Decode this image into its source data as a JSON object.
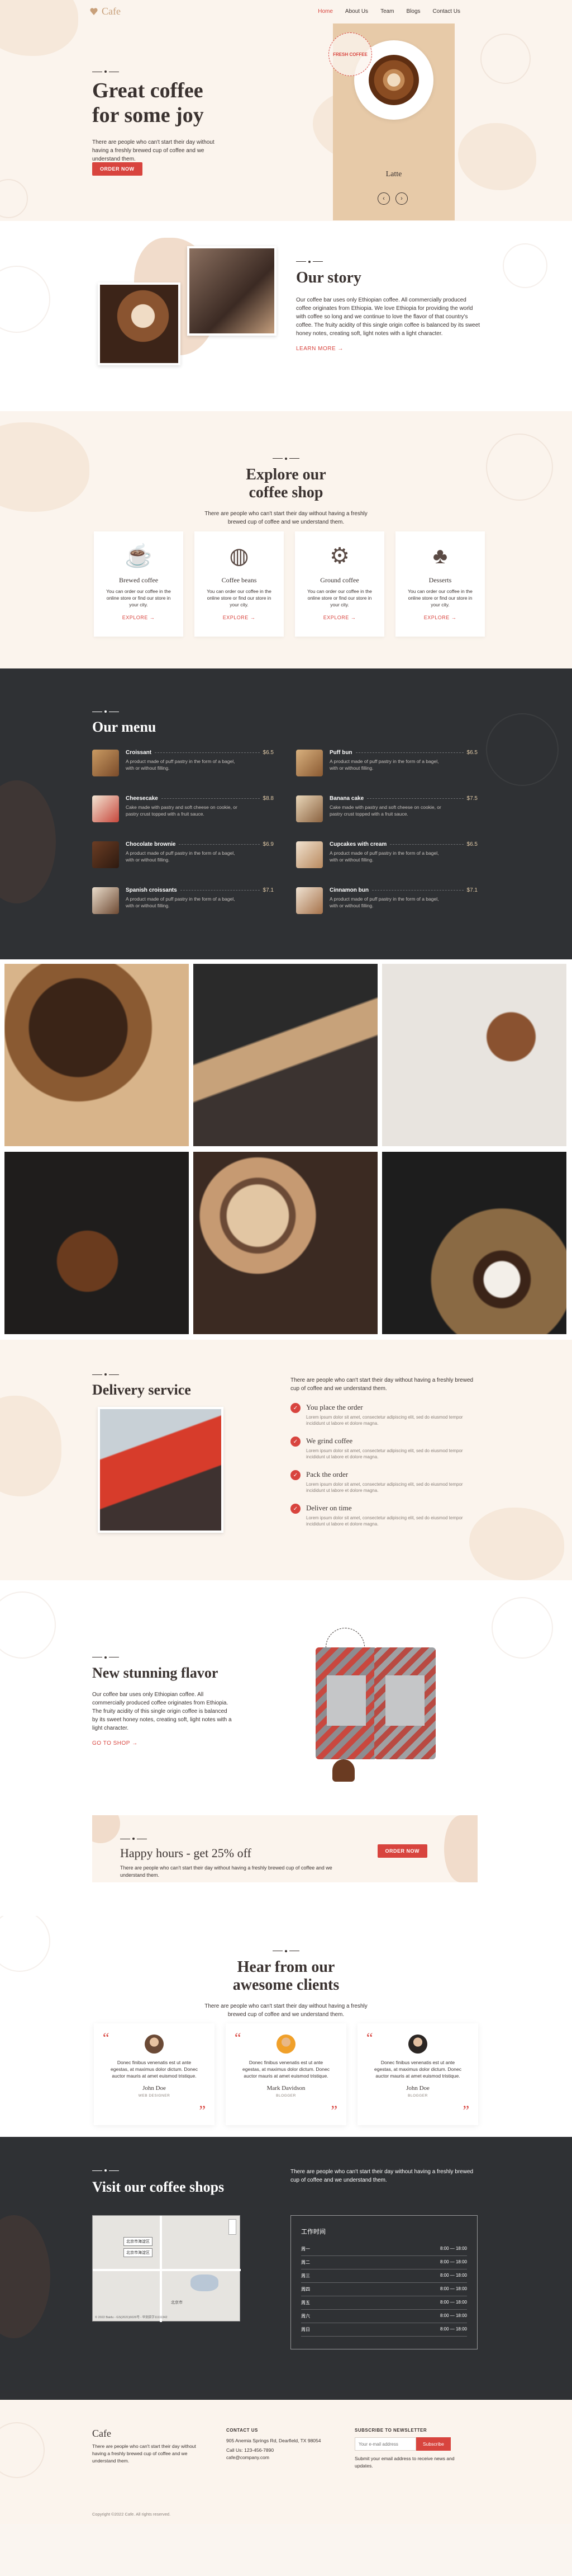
{
  "header": {
    "logo": "Cafe",
    "nav": [
      "Home",
      "About Us",
      "Team",
      "Blogs",
      "Contact Us"
    ]
  },
  "hero": {
    "title_line1": "Great coffee",
    "title_line2": "for some joy",
    "text": "There are people who can't start their day without having a freshly brewed cup of coffee and we understand them.",
    "button": "ORDER NOW",
    "badge": "FRESH COFFEE",
    "cup_label": "Latte",
    "prev": "‹",
    "next": "›"
  },
  "story": {
    "title": "Our story",
    "text": "Our coffee bar uses only Ethiopian coffee. All commercially produced coffee originates from Ethiopia. We love Ethiopia for providing the world with coffee so long and we continue to love the flavor of that country's coffee. The fruity acidity of this single origin coffee is balanced by its sweet honey notes, creating soft, light notes with a light character.",
    "link": "LEARN MORE →"
  },
  "explore": {
    "title_line1": "Explore our",
    "title_line2": "coffee shop",
    "text": "There are people who can't start their day without having a freshly brewed cup of coffee and we understand them.",
    "cards": [
      {
        "title": "Brewed coffee",
        "desc": "You can order our coffee in the online store or find our store in your city.",
        "link": "EXPLORE →",
        "icon": "☕"
      },
      {
        "title": "Coffee beans",
        "desc": "You can order our coffee in the online store or find our store in your city.",
        "link": "EXPLORE →",
        "icon": "◍"
      },
      {
        "title": "Ground coffee",
        "desc": "You can order our coffee in the online store or find our store in your city.",
        "link": "EXPLORE →",
        "icon": "⚙"
      },
      {
        "title": "Desserts",
        "desc": "You can order our coffee in the online store or find our store in your city.",
        "link": "EXPLORE →",
        "icon": "♣"
      }
    ]
  },
  "menu": {
    "title": "Our menu",
    "items": [
      {
        "name": "Croissant",
        "price": "$6.5",
        "desc": "A product made of puff pastry in the form of a bagel, with or without filling."
      },
      {
        "name": "Puff bun",
        "price": "$6.5",
        "desc": "A product made of puff pastry in the form of a bagel, with or without filling."
      },
      {
        "name": "Cheesecake",
        "price": "$8.8",
        "desc": "Cake made with pastry and soft cheese on cookie, or pastry crust topped with a fruit sauce."
      },
      {
        "name": "Banana cake",
        "price": "$7.5",
        "desc": "Cake made with pastry and soft cheese on cookie, or pastry crust topped with a fruit sauce."
      },
      {
        "name": "Chocolate brownie",
        "price": "$6.9",
        "desc": "A product made of puff pastry in the form of a bagel, with or without filling."
      },
      {
        "name": "Cupcakes with cream",
        "price": "$6.5",
        "desc": "A product made of puff pastry in the form of a bagel, with or without filling."
      },
      {
        "name": "Spanish croissants",
        "price": "$7.1",
        "desc": "A product made of puff pastry in the form of a bagel, with or without filling."
      },
      {
        "name": "Cinnamon bun",
        "price": "$7.1",
        "desc": "A product made of puff pastry in the form of a bagel, with or without filling."
      }
    ]
  },
  "delivery": {
    "title": "Delivery service",
    "text": "There are people who can't start their day without having a freshly brewed cup of coffee and we understand them.",
    "steps": [
      {
        "title": "You place the order",
        "desc": "Lorem ipsum dolor sit amet, consectetur adipiscing elit, sed do eiusmod tempor incididunt ut labore et dolore magna."
      },
      {
        "title": "We grind coffee",
        "desc": "Lorem ipsum dolor sit amet, consectetur adipiscing elit, sed do eiusmod tempor incididunt ut labore et dolore magna."
      },
      {
        "title": "Pack the order",
        "desc": "Lorem ipsum dolor sit amet, consectetur adipiscing elit, sed do eiusmod tempor incididunt ut labore et dolore magna."
      },
      {
        "title": "Deliver on time",
        "desc": "Lorem ipsum dolor sit amet, consectetur adipiscing elit, sed do eiusmod tempor incididunt ut labore et dolore magna."
      }
    ]
  },
  "flavor": {
    "title": "New stunning flavor",
    "text": "Our coffee bar uses only Ethiopian coffee. All commercially produced coffee originates from Ethiopia. The fruity acidity of this single origin coffee is balanced by its sweet honey notes, creating soft, light notes with a light character.",
    "link": "GO TO SHOP →"
  },
  "happy": {
    "title": "Happy hours - get 25% off",
    "text": "There are people who can't start their day without having a freshly brewed cup of coffee and we understand them.",
    "button": "ORDER NOW"
  },
  "testimonials": {
    "title_line1": "Hear from our",
    "title_line2": "awesome clients",
    "text": "There are people who can't start their day without having a freshly brewed cup of coffee and we understand them.",
    "items": [
      {
        "text": "Donec finibus venenatis est ut ante egestas, at maximus dolor dictum. Donec auctor mauris at amet euismod tristique.",
        "name": "John Doe",
        "role": "WEB DESIGNER"
      },
      {
        "text": "Donec finibus venenatis est ut ante egestas, at maximus dolor dictum. Donec auctor mauris at amet euismod tristique.",
        "name": "Mark Davidson",
        "role": "BLOGGER"
      },
      {
        "text": "Donec finibus venenatis est ut ante egestas, at maximus dolor dictum. Donec auctor mauris at amet euismod tristique.",
        "name": "John Doe",
        "role": "BLOGGER"
      }
    ]
  },
  "shops": {
    "title": "Visit our coffee shops",
    "text": "There are people who can't start their day without having a freshly brewed cup of coffee and we understand them.",
    "hours_title": "工作时间",
    "hours": [
      {
        "day": "周一",
        "time": "8:00 — 18:00"
      },
      {
        "day": "周二",
        "time": "8:00 — 18:00"
      },
      {
        "day": "周三",
        "time": "8:00 — 18:00"
      },
      {
        "day": "周四",
        "time": "8:00 — 18:00"
      },
      {
        "day": "周五",
        "time": "8:00 — 18:00"
      },
      {
        "day": "周六",
        "time": "8:00 — 18:00"
      },
      {
        "day": "周日",
        "time": "8:00 — 18:00"
      }
    ],
    "map_labels": [
      "北京市海淀区",
      "北京市海淀区",
      "北京市"
    ],
    "map_footer": "© 2022 Baidu - GS(2021)6026号 - 甲测资字11111342"
  },
  "footer": {
    "logo": "Cafe",
    "about": "There are people who can't start their day without having a freshly brewed cup of coffee and we understand them.",
    "contact_h": "CONTACT US",
    "address": "905 Anemia Springs Rd, Dearfield, TX 98054",
    "phone": "Call Us: 123-456-7890",
    "email": "cafe@company.com",
    "nl_h": "SUBSCRIBE TO NEWSLETTER",
    "nl_placeholder": "Your e-mail address",
    "nl_button": "Subscribe",
    "nl_text": "Submit your email address to receive news and updates.",
    "copyright": "Copyright ©2022 Cafe. All rights reserved."
  }
}
